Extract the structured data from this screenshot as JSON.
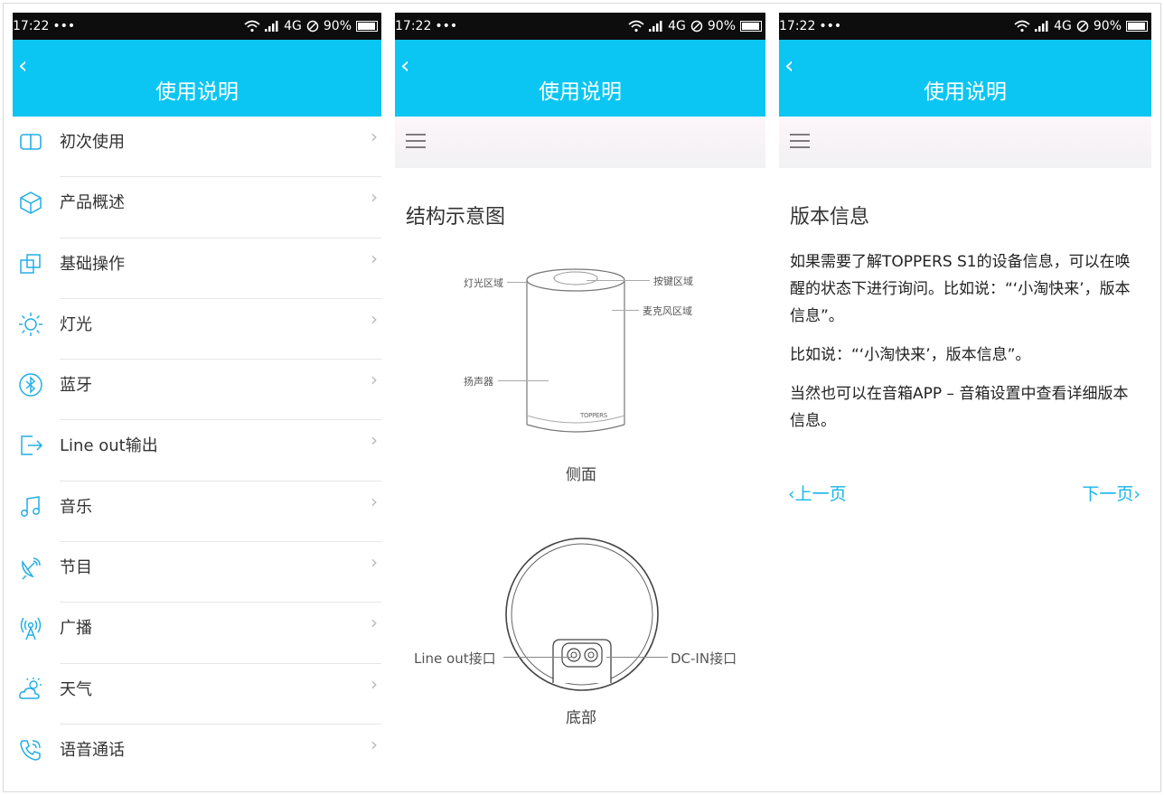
{
  "status": {
    "time": "17:22",
    "dots": "•••",
    "network": "4G",
    "battery": "90%"
  },
  "screens": {
    "list": {
      "title": "使用说明",
      "items": [
        {
          "label": "初次使用",
          "icon": "book-icon"
        },
        {
          "label": "产品概述",
          "icon": "cube-icon"
        },
        {
          "label": "基础操作",
          "icon": "layers-icon"
        },
        {
          "label": "灯光",
          "icon": "sun-icon"
        },
        {
          "label": "蓝牙",
          "icon": "bluetooth-icon"
        },
        {
          "label": "Line out输出",
          "icon": "output-icon"
        },
        {
          "label": "音乐",
          "icon": "music-icon"
        },
        {
          "label": "节目",
          "icon": "satellite-icon"
        },
        {
          "label": "广播",
          "icon": "broadcast-icon"
        },
        {
          "label": "天气",
          "icon": "weather-icon"
        },
        {
          "label": "语音通话",
          "icon": "phone-icon"
        }
      ]
    },
    "structure": {
      "title": "使用说明",
      "heading": "结构示意图",
      "side_caption": "侧面",
      "bottom_caption": "底部",
      "side_labels": {
        "light": "灯光区域",
        "keys": "按键区域",
        "mic": "麦克风区域",
        "speaker": "扬声器",
        "brand": "TOPPERS"
      },
      "bottom_labels": {
        "lineout": "Line out接口",
        "dcin": "DC-IN接口"
      }
    },
    "version": {
      "title": "使用说明",
      "heading": "版本信息",
      "paragraphs": [
        "如果需要了解TOPPERS S1的设备信息，可以在唤醒的状态下进行询问。比如说：“‘小淘快来’，版本信息”。",
        "比如说：“‘小淘快来’，版本信息”。",
        "当然也可以在音箱APP – 音箱设置中查看详细版本信息。"
      ],
      "prev": "上一页",
      "next": "下一页"
    }
  },
  "colors": {
    "accent": "#0bc6f2",
    "link": "#16b6e8",
    "icon": "#22aee6"
  }
}
